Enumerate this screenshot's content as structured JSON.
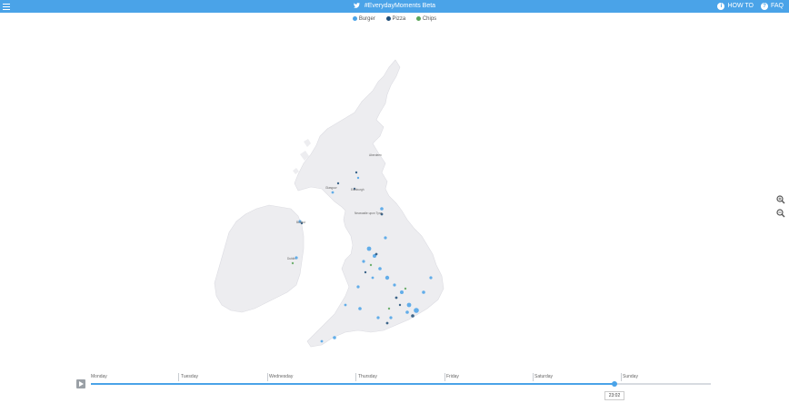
{
  "header": {
    "title": "#EverydayMoments Beta",
    "how_to_label": "HOW TO",
    "faq_label": "FAQ"
  },
  "legend": [
    {
      "label": "Burger",
      "color": "#4aa3e8"
    },
    {
      "label": "Pizza",
      "color": "#1f4e79"
    },
    {
      "label": "Chips",
      "color": "#5aa65a"
    }
  ],
  "map": {
    "cities": [
      "Aberdeen",
      "Edinburgh",
      "Glasgow",
      "Newcastle upon Tyne",
      "Belfast",
      "Dublin"
    ]
  },
  "timeline": {
    "days": [
      "Monday",
      "Tuesday",
      "Wednesday",
      "Thursday",
      "Friday",
      "Saturday",
      "Sunday"
    ],
    "progress": 0.844,
    "time": "23:02"
  }
}
